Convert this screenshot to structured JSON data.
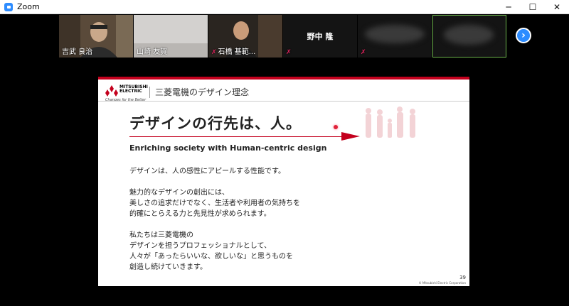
{
  "window": {
    "title": "Zoom"
  },
  "participants": [
    {
      "name": "吉武 良治",
      "muted": false
    },
    {
      "name": "山崎 友賀",
      "muted": false
    },
    {
      "name": "石橋 基範...",
      "muted": true
    },
    {
      "name": "野中 隆",
      "muted": true
    },
    {
      "name": "",
      "muted": true
    },
    {
      "name": "",
      "muted": false
    }
  ],
  "slide": {
    "header": "三菱電機のデザイン理念",
    "logo_text": "MITSUBISHI\nELECTRIC",
    "logo_tagline": "Changes for the Better",
    "title": "デザインの行先は、人。",
    "subtitle": "Enriching society with Human-centric design",
    "paragraphs": [
      "デザインは、人の感性にアピールする性能です。",
      "魅力的なデザインの創出には、\n美しさの追求だけでなく、生活者や利用者の気持ちを\n的確にとらえる力と先見性が求められます。",
      "私たちは三菱電機の\nデザインを担うプロフェッショナルとして、\n人々が「あったらいいな、欲しいな」と思うものを\n創造し続けていきます。"
    ],
    "page_number": "39",
    "copyright": "© Mitsubishi Electric Corporation"
  },
  "colors": {
    "accent": "#c4001d",
    "zoom_blue": "#2d8cff",
    "active_speaker": "#6bb14b"
  }
}
